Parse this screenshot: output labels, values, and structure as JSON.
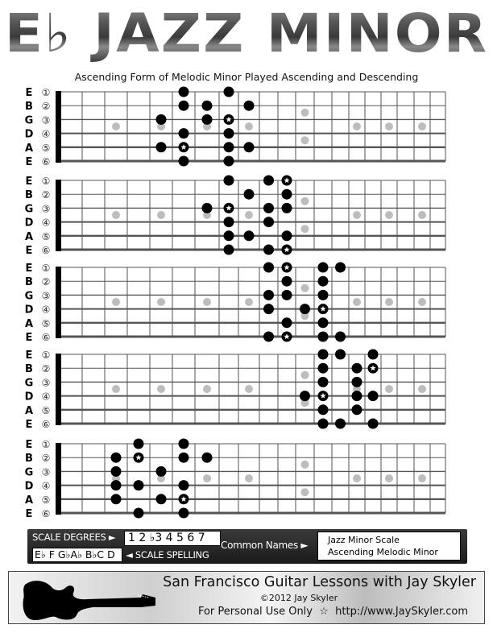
{
  "title": "E♭ JAZZ MINOR",
  "subtitle": "Ascending Form of Melodic Minor Played Ascending and Descending",
  "strings": [
    {
      "name": "E",
      "num": "①"
    },
    {
      "name": "B",
      "num": "②"
    },
    {
      "name": "G",
      "num": "③"
    },
    {
      "name": "D",
      "num": "④"
    },
    {
      "name": "A",
      "num": "⑤"
    },
    {
      "name": "E",
      "num": "⑥"
    }
  ],
  "fretboard": {
    "fret_count": 20,
    "inlays": [
      3,
      5,
      7,
      9,
      15,
      17,
      19
    ],
    "double_inlays": [
      12
    ],
    "colors": {
      "note": "#000000",
      "inlay": "#bdbdbd",
      "root_star": "#ffffff"
    }
  },
  "diagrams": [
    {
      "name": "position-1",
      "notes": [
        [
          1,
          6,
          false
        ],
        [
          1,
          8,
          false
        ],
        [
          2,
          6,
          false
        ],
        [
          2,
          7,
          false
        ],
        [
          2,
          9,
          false
        ],
        [
          3,
          5,
          false
        ],
        [
          3,
          7,
          false
        ],
        [
          3,
          8,
          true
        ],
        [
          4,
          6,
          false
        ],
        [
          4,
          8,
          false
        ],
        [
          5,
          5,
          false
        ],
        [
          5,
          6,
          true
        ],
        [
          5,
          8,
          false
        ],
        [
          5,
          9,
          false
        ],
        [
          6,
          6,
          false
        ],
        [
          6,
          8,
          false
        ]
      ]
    },
    {
      "name": "position-2",
      "notes": [
        [
          1,
          8,
          false
        ],
        [
          1,
          10,
          false
        ],
        [
          1,
          11,
          true
        ],
        [
          2,
          9,
          false
        ],
        [
          2,
          11,
          false
        ],
        [
          3,
          7,
          false
        ],
        [
          3,
          8,
          true
        ],
        [
          3,
          10,
          false
        ],
        [
          3,
          11,
          false
        ],
        [
          4,
          8,
          false
        ],
        [
          4,
          10,
          false
        ],
        [
          5,
          8,
          false
        ],
        [
          5,
          9,
          false
        ],
        [
          5,
          11,
          false
        ],
        [
          6,
          8,
          false
        ],
        [
          6,
          10,
          false
        ],
        [
          6,
          11,
          true
        ]
      ]
    },
    {
      "name": "position-3",
      "notes": [
        [
          1,
          10,
          false
        ],
        [
          1,
          11,
          true
        ],
        [
          1,
          13,
          false
        ],
        [
          1,
          14,
          false
        ],
        [
          2,
          11,
          false
        ],
        [
          2,
          13,
          false
        ],
        [
          3,
          10,
          false
        ],
        [
          3,
          11,
          false
        ],
        [
          3,
          13,
          false
        ],
        [
          4,
          10,
          false
        ],
        [
          4,
          12,
          false
        ],
        [
          4,
          13,
          true
        ],
        [
          5,
          11,
          false
        ],
        [
          5,
          13,
          false
        ],
        [
          6,
          10,
          false
        ],
        [
          6,
          11,
          true
        ],
        [
          6,
          13,
          false
        ],
        [
          6,
          14,
          false
        ]
      ]
    },
    {
      "name": "position-4",
      "notes": [
        [
          1,
          13,
          false
        ],
        [
          1,
          14,
          false
        ],
        [
          1,
          16,
          false
        ],
        [
          2,
          13,
          false
        ],
        [
          2,
          15,
          false
        ],
        [
          2,
          16,
          true
        ],
        [
          3,
          13,
          false
        ],
        [
          3,
          15,
          false
        ],
        [
          4,
          12,
          false
        ],
        [
          4,
          13,
          true
        ],
        [
          4,
          15,
          false
        ],
        [
          4,
          16,
          false
        ],
        [
          5,
          13,
          false
        ],
        [
          5,
          15,
          false
        ],
        [
          6,
          13,
          false
        ],
        [
          6,
          14,
          false
        ],
        [
          6,
          16,
          false
        ]
      ]
    },
    {
      "name": "position-5",
      "notes": [
        [
          1,
          4,
          false
        ],
        [
          1,
          6,
          false
        ],
        [
          2,
          3,
          false
        ],
        [
          2,
          4,
          true
        ],
        [
          2,
          6,
          false
        ],
        [
          2,
          7,
          false
        ],
        [
          3,
          3,
          false
        ],
        [
          3,
          5,
          false
        ],
        [
          4,
          3,
          false
        ],
        [
          4,
          4,
          false
        ],
        [
          4,
          6,
          false
        ],
        [
          5,
          3,
          false
        ],
        [
          5,
          5,
          false
        ],
        [
          5,
          6,
          true
        ],
        [
          6,
          4,
          false
        ],
        [
          6,
          6,
          false
        ]
      ]
    }
  ],
  "legend": {
    "scale_degrees_label": "SCALE DEGREES ►",
    "scale_degrees": "1 2 ♭3 4 5 6  7",
    "scale_spelling": "E♭ F G♭A♭ B♭C D",
    "scale_spelling_label": "◄ SCALE SPELLING",
    "common_names_label": "Common Names ►",
    "common_names": [
      "Jazz Minor Scale",
      "Ascending Melodic Minor"
    ]
  },
  "footer": {
    "heading": "San Francisco Guitar Lessons with Jay Skyler",
    "copyright": "©2012 Jay Skyler",
    "usage": "For Personal Use Only  ☆  http://www.JaySkyler.com"
  }
}
